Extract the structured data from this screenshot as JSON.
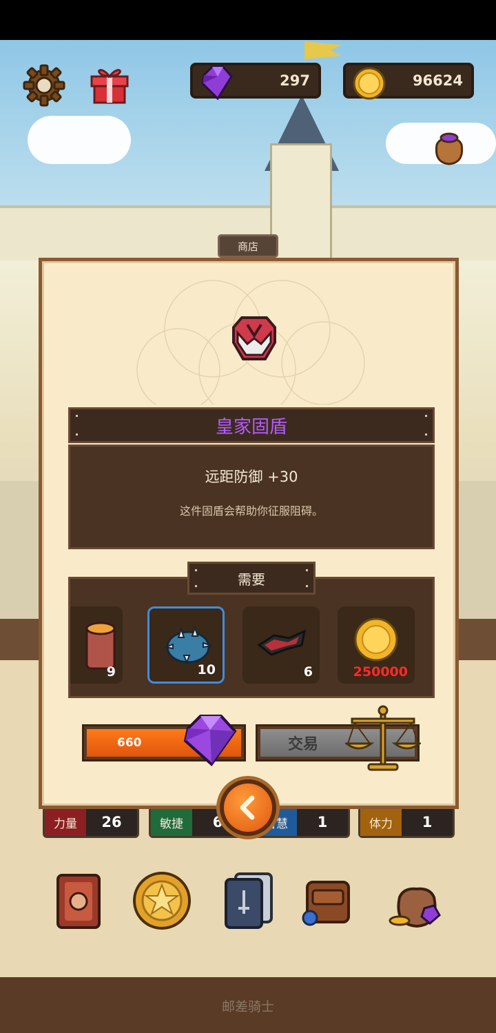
{
  "currencies": {
    "gems": "297",
    "coins": "96624"
  },
  "shop": {
    "tab_label": "商店",
    "item_name": "皇家固盾",
    "item_stat": "远距防御 +30",
    "item_description": "这件固盾会帮助你征服阻碍。",
    "requirements_label": "需要",
    "requirements": [
      {
        "icon": "wood-log-icon",
        "count": "9"
      },
      {
        "icon": "spiked-shell-icon",
        "count": "10"
      },
      {
        "icon": "cloth-scrap-icon",
        "count": "6"
      },
      {
        "icon": "gold-coin-icon",
        "count": "250000"
      }
    ],
    "gem_price": "660",
    "trade_label": "交易"
  },
  "stats": [
    {
      "label": "力量",
      "value": "26",
      "color": "#8c1f22"
    },
    {
      "label": "敏捷",
      "value": "6",
      "color": "#1f6b3a"
    },
    {
      "label": "智慧",
      "value": "1",
      "color": "#1f5b9c"
    },
    {
      "label": "体力",
      "value": "1",
      "color": "#a3620e"
    }
  ],
  "footer": {
    "title": "邮差骑士"
  },
  "colors": {
    "item_name": "#b45cff",
    "buy_button": "#ff7a1a",
    "selected_slot": "#3f8de0",
    "coin_price": "#ff2a2a"
  }
}
